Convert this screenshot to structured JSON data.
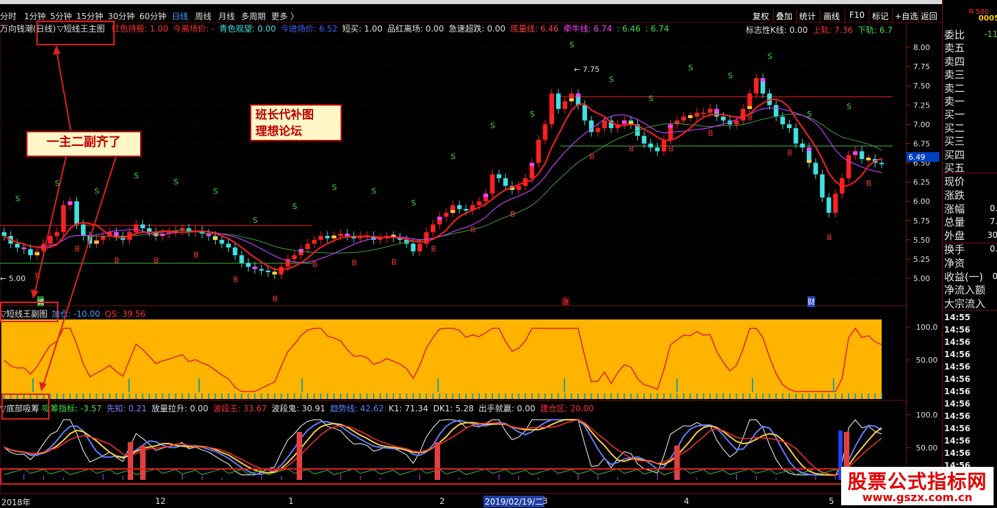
{
  "toolbar": {
    "tabs": [
      "分时",
      "1分钟",
      "5分钟",
      "15分钟",
      "30分钟",
      "60分钟",
      "日线",
      "周线",
      "月线",
      "多周期",
      "更多"
    ],
    "active_tab": "日线",
    "right_buttons": [
      "复权",
      "叠加",
      "统计",
      "画线",
      "F10",
      "标记",
      "+自选",
      "返回"
    ]
  },
  "main_info": {
    "title": "万向钱潮(日线)",
    "indicator": "▽短线王主图",
    "items": [
      {
        "text": "红色持股: 1.00",
        "color": "#ff3030"
      },
      {
        "text": "今离场价: -",
        "color": "#ff3030"
      },
      {
        "text": "青色观望: 0.00",
        "color": "#40e0e0"
      },
      {
        "text": "今进场价: 6.52",
        "color": "#4060ff"
      },
      {
        "text": "短买: 1.00",
        "color": "#e0e0e0"
      },
      {
        "text": "品红离场: 0.00",
        "color": "#e0e0e0"
      },
      {
        "text": "急速超跌: 0.00",
        "color": "#e0e0e0"
      },
      {
        "text": "底量线: 6.46",
        "color": "#ff4040"
      },
      {
        "text": "牵牛线: 6.74",
        "color": "#ff40ff"
      },
      {
        "text": ": 6.46",
        "color": "#40e040"
      },
      {
        "text": ": 6.74",
        "color": "#40e040"
      }
    ],
    "right_items": [
      {
        "text": "标志性K线: 0.00",
        "color": "#e0e0e0"
      },
      {
        "text": "上轨: 7.36",
        "color": "#ff3030"
      },
      {
        "text": "下轨: 6.7",
        "color": "#40e040"
      }
    ]
  },
  "price_axis": [
    "8.00",
    "7.75",
    "7.50",
    "7.25",
    "7.00",
    "6.75",
    "6.50",
    "6.25",
    "6.00",
    "5.75",
    "5.50",
    "5.25",
    "5.00"
  ],
  "price_marker": "6.49",
  "high_label": "7.75",
  "low_label": "5.00",
  "sub1_info": {
    "title": "▽短线王副图",
    "items": [
      {
        "text": "加仓: -10.00",
        "color": "#40a0ff"
      },
      {
        "text": "QS: 39.56",
        "color": "#ff3030"
      }
    ],
    "axis": [
      "100.0",
      "50.00"
    ]
  },
  "sub2_info": {
    "title": "▽底部吸筹",
    "items": [
      {
        "text": "吸筹指标: -3.57",
        "color": "#40e040"
      },
      {
        "text": "先知: 0.21",
        "color": "#8080ff"
      },
      {
        "text": "放量拉升: 0.00",
        "color": "#e0e0e0"
      },
      {
        "text": "波段王: 33.67",
        "color": "#ff3030"
      },
      {
        "text": "波段鬼: 30.91",
        "color": "#e0e0e0"
      },
      {
        "text": "趋势线: 42.62",
        "color": "#6080ff"
      },
      {
        "text": "K1: 71.34",
        "color": "#e0e0e0"
      },
      {
        "text": "DK1: 5.28",
        "color": "#e0e0e0"
      },
      {
        "text": "出手就赢: 0.00",
        "color": "#e0e0e0"
      },
      {
        "text": "建仓区: 20.00",
        "color": "#ff3030"
      }
    ],
    "axis": [
      "100.0",
      "50.00"
    ]
  },
  "date_axis": [
    "2018年",
    "12",
    "1",
    "2",
    "2019/02/19/二",
    "3",
    "4",
    "5"
  ],
  "event_marks": [
    "涨",
    "财",
    "诚"
  ],
  "annotations": {
    "center_box": [
      "班长代补图",
      "理想论坛"
    ],
    "left_box": "一主二副齐了"
  },
  "right_panel": {
    "labels": [
      "委比",
      "卖五",
      "卖四",
      "卖三",
      "卖二",
      "卖一",
      "买一",
      "买二",
      "买三",
      "买四",
      "买五",
      "现价",
      "涨跌",
      "涨幅",
      "总量",
      "外盘",
      "换手",
      "净资",
      "收益(一)",
      "净流入额",
      "大宗流入"
    ],
    "values": [
      "-11",
      "",
      "",
      "",
      "",
      "",
      "",
      "",
      "",
      "",
      "",
      "",
      "",
      "0.",
      "7.",
      "30",
      "0.",
      "",
      "0",
      "",
      ""
    ],
    "code": "0005",
    "small_label": "R 500",
    "times": [
      "14:55",
      "14:56",
      "14:56",
      "14:56",
      "14:56",
      "14:56",
      "14:56",
      "14:56",
      "14:56",
      "14:56",
      "14:56",
      "14:56",
      "14:56",
      "14:56",
      "14:56",
      "14:56"
    ]
  },
  "watermark": {
    "line1": "股票公式指标网",
    "line2": "www.gszx.com.cn"
  },
  "colors": {
    "up": "#ff2020",
    "down": "#40e0e0",
    "ma_red": "#ff2020",
    "ma_purple": "#c040ff",
    "ma_green": "#40c040",
    "sub1_bg": "#ffb400",
    "frame": "#7a1010"
  },
  "chart_data": {
    "type": "candlestick",
    "ylim": [
      4.9,
      8.1
    ],
    "closes": [
      5.55,
      5.45,
      5.4,
      5.38,
      5.3,
      5.35,
      5.45,
      5.55,
      5.6,
      5.95,
      6.0,
      5.7,
      5.55,
      5.45,
      5.5,
      5.55,
      5.6,
      5.55,
      5.5,
      5.6,
      5.7,
      5.65,
      5.6,
      5.55,
      5.58,
      5.6,
      5.62,
      5.65,
      5.6,
      5.62,
      5.58,
      5.55,
      5.5,
      5.45,
      5.4,
      5.3,
      5.2,
      5.15,
      5.12,
      5.1,
      5.08,
      5.05,
      5.15,
      5.25,
      5.3,
      5.38,
      5.45,
      5.5,
      5.55,
      5.52,
      5.55,
      5.58,
      5.55,
      5.52,
      5.55,
      5.55,
      5.5,
      5.52,
      5.55,
      5.53,
      5.5,
      5.45,
      5.35,
      5.45,
      5.6,
      5.7,
      5.8,
      5.85,
      5.95,
      5.9,
      5.88,
      5.95,
      6.0,
      6.1,
      6.35,
      6.3,
      6.2,
      6.15,
      6.2,
      6.3,
      6.5,
      6.8,
      7.0,
      7.4,
      7.2,
      7.3,
      7.4,
      7.25,
      7.05,
      6.9,
      6.95,
      7.05,
      6.95,
      7.0,
      7.05,
      7.0,
      6.85,
      6.75,
      6.7,
      6.65,
      6.8,
      7.0,
      7.05,
      7.1,
      7.1,
      7.15,
      7.15,
      7.2,
      7.1,
      7.05,
      7.0,
      7.05,
      7.2,
      7.4,
      7.6,
      7.4,
      7.25,
      7.1,
      7.0,
      6.95,
      6.75,
      6.7,
      6.5,
      6.35,
      6.05,
      5.85,
      6.1,
      6.3,
      6.6,
      6.65,
      6.55,
      6.55,
      6.5,
      6.49
    ]
  }
}
